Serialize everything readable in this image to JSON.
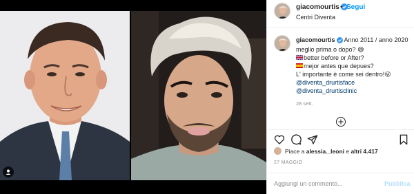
{
  "post": {
    "username": "giacomourtis",
    "location": "Centri Diventa",
    "follow_label": "Segui",
    "dot": "•",
    "caption": {
      "username": "giacomourtis",
      "line1": "Anno 2011 / anno 2020 meglio prima o dopo?",
      "emoji_grin": "😅",
      "line2": "better before or After?",
      "line3": "mejor antes que depues?",
      "line4": "L' importante è come sei dentro!",
      "emoji_end": "😜",
      "mention1": "@diventa_drurtisface",
      "mention2": "@diventa_drurtisclinic",
      "time": "28 sett."
    },
    "likes": {
      "prefix": "Piace a ",
      "user": "alessia._leoni",
      "middle": " e ",
      "others": "altri 4.417"
    },
    "date": "27 MAGGIO",
    "comment_placeholder": "Aggiungi un commento...",
    "publish_label": "Pubblica"
  },
  "colors": {
    "link_blue": "#0095f6",
    "publish_disabled": "#b2dffc",
    "verified_blue": "#3897f0"
  },
  "icons": [
    "verified-icon",
    "heart-icon",
    "comment-icon",
    "share-icon",
    "bookmark-icon",
    "plus-circle-icon",
    "user-tag-icon"
  ]
}
